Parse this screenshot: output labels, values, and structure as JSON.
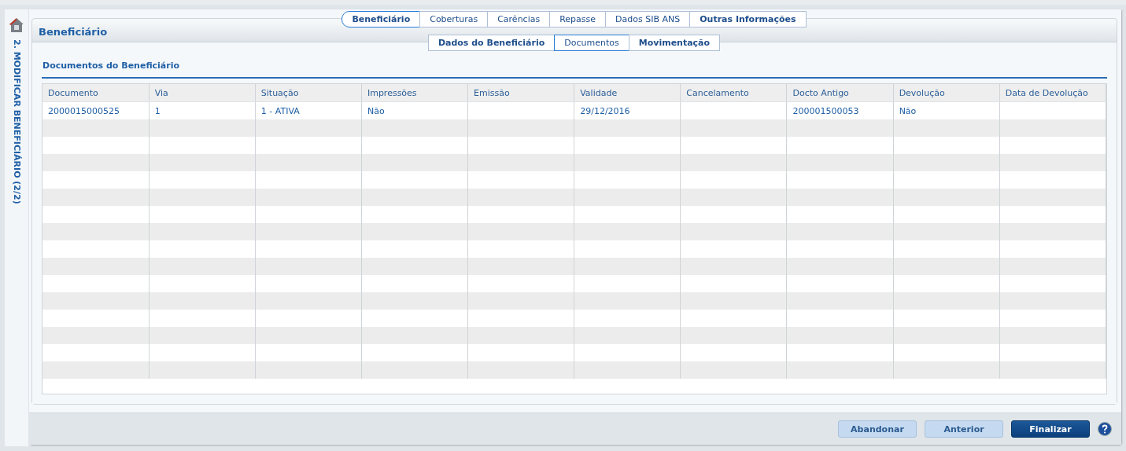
{
  "sidebar": {
    "title": "2. MODIFICAR BENEFICIÁRIO (2/2)"
  },
  "tabs": [
    {
      "label": "Beneficiário",
      "selected": true,
      "bold": true
    },
    {
      "label": "Coberturas",
      "selected": false,
      "bold": false
    },
    {
      "label": "Carências",
      "selected": false,
      "bold": false
    },
    {
      "label": "Repasse",
      "selected": false,
      "bold": false
    },
    {
      "label": "Dados SIB ANS",
      "selected": false,
      "bold": false
    },
    {
      "label": "Outras Informações",
      "selected": false,
      "bold": true
    }
  ],
  "panel": {
    "title": "Beneficiário"
  },
  "subtabs": [
    {
      "label": "Dados do Beneficiário",
      "selected": false,
      "bold": true
    },
    {
      "label": "Documentos",
      "selected": true,
      "bold": false
    },
    {
      "label": "Movimentação",
      "selected": false,
      "bold": true
    }
  ],
  "section": {
    "title": "Documentos do Beneficiário"
  },
  "table": {
    "columns": [
      "Documento",
      "Via",
      "Situação",
      "Impressões",
      "Emissão",
      "Validade",
      "Cancelamento",
      "Docto Antigo",
      "Devolução",
      "Data de Devolução"
    ],
    "rows": [
      [
        "2000015000525",
        "1",
        "1 - ATIVA",
        "Não",
        "",
        "29/12/2016",
        "",
        "200001500053",
        "Não",
        ""
      ]
    ]
  },
  "buttons": [
    {
      "label": "Abandonar",
      "kind": "secondary"
    },
    {
      "label": "Anterior",
      "kind": "secondary"
    },
    {
      "label": "Finalizar",
      "kind": "primary"
    }
  ]
}
